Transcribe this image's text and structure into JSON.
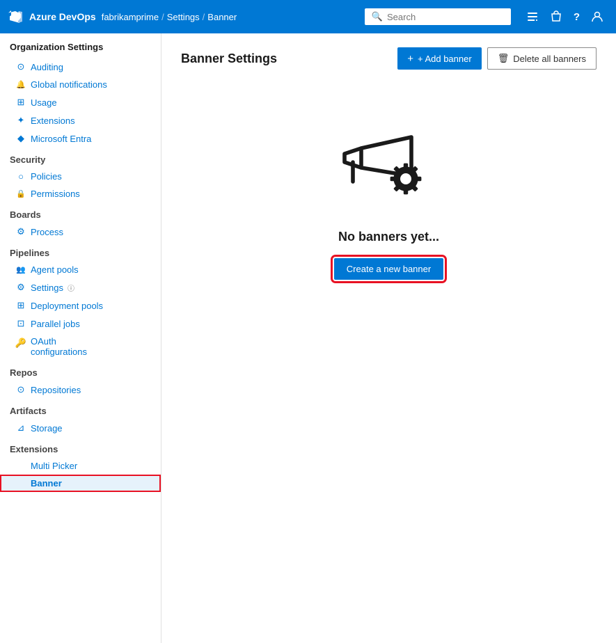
{
  "topbar": {
    "logo_text": "Azure DevOps",
    "breadcrumb": {
      "org": "fabrikamprime",
      "sep1": "/",
      "section": "Settings",
      "sep2": "/",
      "page": "Banner"
    },
    "search_placeholder": "Search",
    "icons": {
      "settings_list": "≡",
      "lock": "🔒",
      "help": "?",
      "user": "👤"
    }
  },
  "sidebar": {
    "title": "Organization Settings",
    "sections": [
      {
        "id": "general",
        "items": [
          {
            "id": "auditing",
            "label": "Auditing",
            "icon": "⊙"
          },
          {
            "id": "global-notifications",
            "label": "Global notifications",
            "icon": "🔔"
          },
          {
            "id": "usage",
            "label": "Usage",
            "icon": "⊞"
          },
          {
            "id": "extensions",
            "label": "Extensions",
            "icon": "✦"
          },
          {
            "id": "microsoft-entra",
            "label": "Microsoft Entra",
            "icon": "◆"
          }
        ]
      },
      {
        "id": "security",
        "header": "Security",
        "items": [
          {
            "id": "policies",
            "label": "Policies",
            "icon": "○"
          },
          {
            "id": "permissions",
            "label": "Permissions",
            "icon": "🔒"
          }
        ]
      },
      {
        "id": "boards",
        "header": "Boards",
        "items": [
          {
            "id": "process",
            "label": "Process",
            "icon": "⚙"
          }
        ]
      },
      {
        "id": "pipelines",
        "header": "Pipelines",
        "items": [
          {
            "id": "agent-pools",
            "label": "Agent pools",
            "icon": "👥"
          },
          {
            "id": "settings",
            "label": "Settings",
            "icon": "⚙"
          },
          {
            "id": "deployment-pools",
            "label": "Deployment pools",
            "icon": "⊞"
          },
          {
            "id": "parallel-jobs",
            "label": "Parallel jobs",
            "icon": "⊡"
          },
          {
            "id": "oauth-configurations",
            "label": "OAuth configurations",
            "icon": "🔑"
          }
        ]
      },
      {
        "id": "repos",
        "header": "Repos",
        "items": [
          {
            "id": "repositories",
            "label": "Repositories",
            "icon": "⊙"
          }
        ]
      },
      {
        "id": "artifacts",
        "header": "Artifacts",
        "items": [
          {
            "id": "storage",
            "label": "Storage",
            "icon": "⊿"
          }
        ]
      },
      {
        "id": "extensions-section",
        "header": "Extensions",
        "items": [
          {
            "id": "multi-picker",
            "label": "Multi Picker",
            "icon": ""
          },
          {
            "id": "banner",
            "label": "Banner",
            "icon": "",
            "active": true
          }
        ]
      }
    ]
  },
  "content": {
    "title": "Banner Settings",
    "add_banner_label": "+ Add banner",
    "delete_all_label": "Delete all banners",
    "empty_state": {
      "text": "No banners yet...",
      "create_button_label": "Create a new banner"
    }
  },
  "colors": {
    "primary": "#0078d4",
    "danger": "#e81123",
    "link": "#0078d4"
  }
}
